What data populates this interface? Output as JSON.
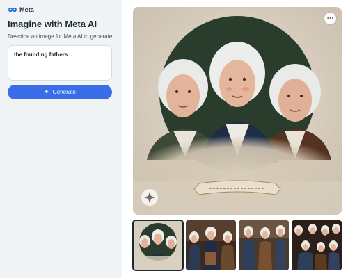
{
  "brand": {
    "name": "Meta",
    "logo_icon": "meta-infinity-icon"
  },
  "panel": {
    "title": "Imagine with Meta AI",
    "subtitle": "Describe an image for Meta AI to generate."
  },
  "prompt": {
    "value": "the founding fathers"
  },
  "generate": {
    "label": "Generate",
    "icon": "sparkle-icon"
  },
  "image": {
    "more_icon": "more-dots-icon",
    "watermark_icon": "imagine-watermark-icon",
    "thumbnail_count": 4,
    "selected_thumbnail": 1
  },
  "colors": {
    "accent": "#3a6ee8",
    "panel_bg": "#f1f4f7",
    "text": "#1c2b33"
  }
}
